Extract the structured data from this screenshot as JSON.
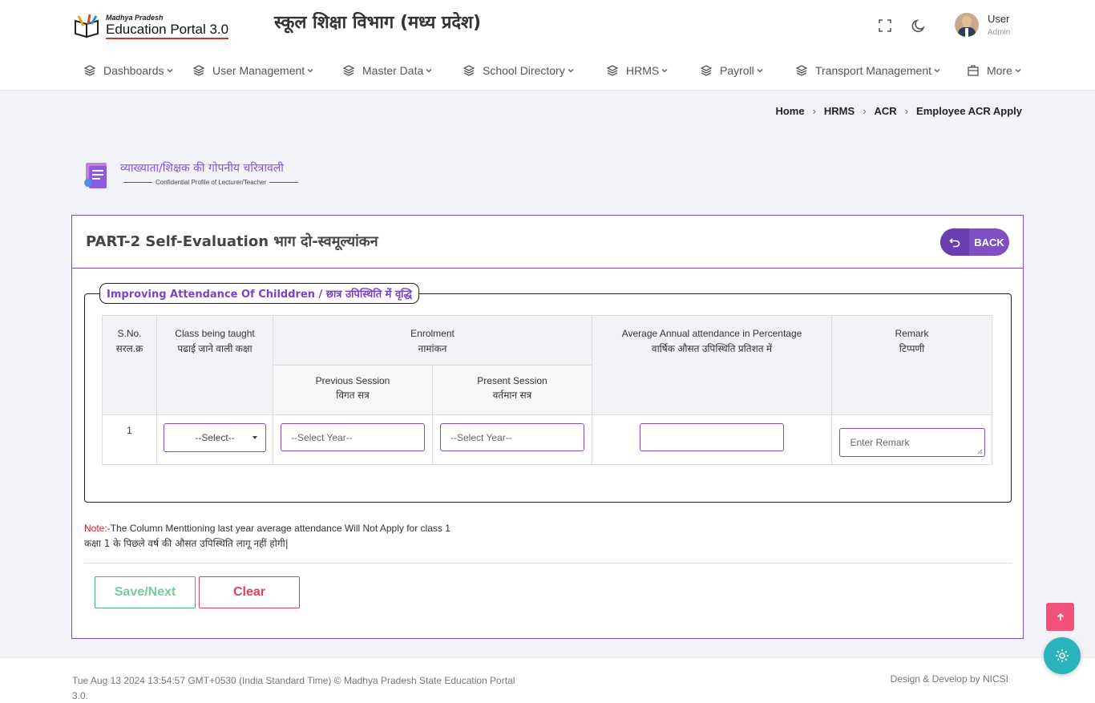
{
  "header": {
    "logo_small": "Madhya Pradesh",
    "logo_big": "Education Portal 3.0",
    "site_title": "स्कूल शिक्षा विभाग (मध्य प्रदेश)",
    "user_name": "User",
    "user_role": "Admin"
  },
  "nav": [
    {
      "label": "Dashboards",
      "icon": "layers-icon"
    },
    {
      "label": "User Management",
      "icon": "layers-icon"
    },
    {
      "label": "Master Data",
      "icon": "layers-icon"
    },
    {
      "label": "School Directory",
      "icon": "layers-icon"
    },
    {
      "label": "HRMS",
      "icon": "layers-icon"
    },
    {
      "label": "Payroll",
      "icon": "layers-icon"
    },
    {
      "label": "Transport Management",
      "icon": "layers-icon"
    },
    {
      "label": "More",
      "icon": "building-icon"
    }
  ],
  "breadcrumb": [
    "Home",
    "HRMS",
    "ACR",
    "Employee ACR Apply"
  ],
  "section": {
    "title": "व्याख्याता/शिक्षक की गोपनीय चरित्रावली",
    "subtitle": "Confidential Profile of Lecturer/Teacher"
  },
  "card": {
    "title": "PART-2 Self-Evaluation भाग दो-स्वमूल्यांकन",
    "back_label": "BACK"
  },
  "fieldset": {
    "legend": "Improving Attendance Of Childdren / छात्र उपिस्थिति में वृद्धि"
  },
  "table": {
    "headers": {
      "sno_en": "S.No.",
      "sno_hi": "सरल.क्र",
      "class_en": "Class being taught",
      "class_hi": "पढाई जाने वाली कक्षा",
      "enrol_en": "Enrolment",
      "enrol_hi": "नामांकन",
      "avg_en": "Average Annual attendance in Percentage",
      "avg_hi": "वार्षिक औसत उपिस्थिति प्रतिशत में",
      "remark_en": "Remark",
      "remark_hi": "टिप्पणी",
      "prev_en": "Previous Session",
      "prev_hi": "विगत सत्र",
      "pres_en": "Present Session",
      "pres_hi": "वर्तमान सत्र"
    },
    "row": {
      "sno": "1",
      "class_select": "--Select--",
      "prev_placeholder": "--Select Year--",
      "pres_placeholder": "--Select Year--",
      "avg_value": "",
      "remark_placeholder": "Enter Remark"
    }
  },
  "note": {
    "prefix": "Note:-",
    "text_en": "The Column Menttioning last year average attendance Will Not Apply for class 1",
    "text_hi": "कक्षा 1 के पिछले वर्ष की औसत उपिस्थिति लागू नहीं होगी|"
  },
  "buttons": {
    "save": "Save/Next",
    "clear": "Clear"
  },
  "footer": {
    "left": "Tue Aug 13 2024 13:54:57 GMT+0530 (India Standard Time) © Madhya Pradesh State Education Portal 3.0.",
    "right": "Design & Develop by NICSI"
  },
  "colors": {
    "accent": "#7e4fc4",
    "to_top": "#f2517a",
    "settings": "#2ab3b8"
  }
}
